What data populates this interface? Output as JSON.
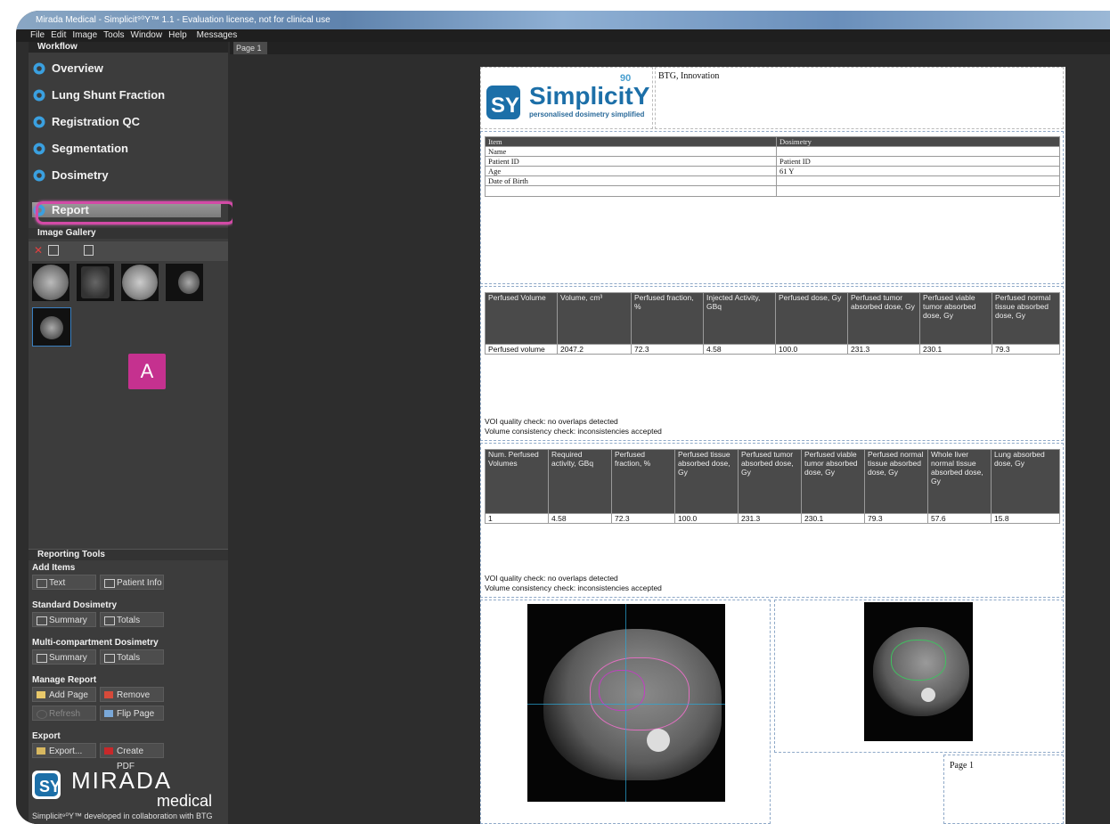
{
  "window": {
    "title": "Mirada Medical - Simplicit⁹⁰Y™ 1.1 - Evaluation license, not for clinical use"
  },
  "menu": {
    "file": "File",
    "edit": "Edit",
    "image": "Image",
    "tools": "Tools",
    "window": "Window",
    "help": "Help",
    "messages": "Messages"
  },
  "workflow": {
    "header": "Workflow",
    "items": [
      "Overview",
      "Lung Shunt Fraction",
      "Registration QC",
      "Segmentation",
      "Dosimetry",
      "Report"
    ]
  },
  "gallery": {
    "header": "Image Gallery"
  },
  "badge": "A",
  "reporting_tools": {
    "header": "Reporting Tools",
    "add_items": "Add Items",
    "text_btn": "Text",
    "patient_info_btn": "Patient Info",
    "standard": "Standard Dosimetry",
    "summary_btn": "Summary",
    "totals_btn": "Totals",
    "multi": "Multi-compartment Dosimetry",
    "summary_btn2": "Summary",
    "totals_btn2": "Totals",
    "manage": "Manage Report",
    "add_page": "Add Page",
    "remove_page": "Remove Page",
    "refresh": "Refresh",
    "flip_page": "Flip Page",
    "export": "Export",
    "export_btn": "Export...",
    "create_pdf": "Create PDF"
  },
  "brand": {
    "mirada": "MIRADA",
    "medical": "medical",
    "tagline": "Simplicit⁹⁰Y™ developed in collaboration with BTG"
  },
  "tab": {
    "page1": "Page 1"
  },
  "report": {
    "logo_text": "SimplicitY",
    "logo_sup": "90",
    "logo_tagline": "personalised dosimetry simplified",
    "org": "BTG, Innovation",
    "patient_table": {
      "headers": [
        "Item",
        "Dosimetry"
      ],
      "rows": [
        [
          "Name",
          ""
        ],
        [
          "Patient ID",
          "Patient ID"
        ],
        [
          "Age",
          "61 Y"
        ],
        [
          "Date of Birth",
          ""
        ],
        [
          "",
          ""
        ]
      ]
    },
    "dose_table": {
      "headers": [
        "Perfused Volume",
        "Volume, cm³",
        "Perfused fraction, %",
        "Injected Activity, GBq",
        "Perfused dose, Gy",
        "Perfused tumor absorbed dose, Gy",
        "Perfused viable tumor absorbed dose, Gy",
        "Perfused normal tissue absorbed dose, Gy"
      ],
      "row": [
        "Perfused volume",
        "2047.2",
        "72.3",
        "4.58",
        "100.0",
        "231.3",
        "230.1",
        "79.3"
      ]
    },
    "check1": "VOI quality check: no overlaps detected",
    "check2": "Volume consistency check: inconsistencies accepted",
    "totals_table": {
      "headers": [
        "Num. Perfused Volumes",
        "Required activity, GBq",
        "Perfused fraction, %",
        "Perfused tissue absorbed dose, Gy",
        "Perfused tumor absorbed dose, Gy",
        "Perfused viable tumor absorbed dose, Gy",
        "Perfused normal tissue absorbed dose, Gy",
        "Whole liver normal tissue absorbed dose, Gy",
        "Lung absorbed dose, Gy"
      ],
      "row": [
        "1",
        "4.58",
        "72.3",
        "100.0",
        "231.3",
        "230.1",
        "79.3",
        "57.6",
        "15.8"
      ]
    },
    "check3": "VOI quality check: no overlaps detected",
    "check4": "Volume consistency check: inconsistencies accepted",
    "page_label": "Page 1"
  },
  "colors": {
    "accent": "#c5318f",
    "panel": "#3c3c3c",
    "gear": "#3aa0e0"
  }
}
